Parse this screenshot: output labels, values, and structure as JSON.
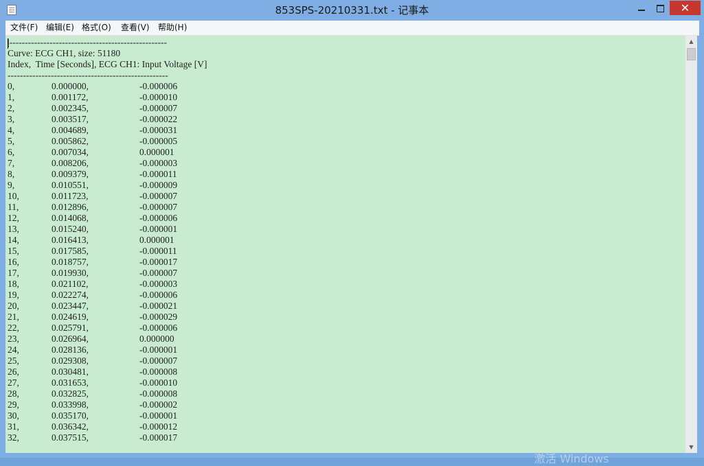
{
  "window": {
    "title": "853SPS-20210331.txt - 记事本",
    "minimize_glyph": "",
    "maximize_glyph": "",
    "close_glyph": "✕"
  },
  "menu": [
    {
      "label": "文件(F)"
    },
    {
      "label": "编辑(E)"
    },
    {
      "label": "格式(O)"
    },
    {
      "label": "查看(V)"
    },
    {
      "label": "帮助(H)"
    }
  ],
  "document": {
    "header_lines": [
      "|---------------------------------------------------",
      "Curve: ECG CH1, size: 51180",
      "Index,  Time [Seconds], ECG CH1: Input Voltage [V]",
      "----------------------------------------------------"
    ],
    "rows": [
      [
        "0,",
        "0.000000,",
        "-0.000006"
      ],
      [
        "1,",
        "0.001172,",
        "-0.000010"
      ],
      [
        "2,",
        "0.002345,",
        "-0.000007"
      ],
      [
        "3,",
        "0.003517,",
        "-0.000022"
      ],
      [
        "4,",
        "0.004689,",
        "-0.000031"
      ],
      [
        "5,",
        "0.005862,",
        "-0.000005"
      ],
      [
        "6,",
        "0.007034,",
        "0.000001"
      ],
      [
        "7,",
        "0.008206,",
        "-0.000003"
      ],
      [
        "8,",
        "0.009379,",
        "-0.000011"
      ],
      [
        "9,",
        "0.010551,",
        "-0.000009"
      ],
      [
        "10,",
        "0.011723,",
        "-0.000007"
      ],
      [
        "11,",
        "0.012896,",
        "-0.000007"
      ],
      [
        "12,",
        "0.014068,",
        "-0.000006"
      ],
      [
        "13,",
        "0.015240,",
        "-0.000001"
      ],
      [
        "14,",
        "0.016413,",
        "0.000001"
      ],
      [
        "15,",
        "0.017585,",
        "-0.000011"
      ],
      [
        "16,",
        "0.018757,",
        "-0.000017"
      ],
      [
        "17,",
        "0.019930,",
        "-0.000007"
      ],
      [
        "18,",
        "0.021102,",
        "-0.000003"
      ],
      [
        "19,",
        "0.022274,",
        "-0.000006"
      ],
      [
        "20,",
        "0.023447,",
        "-0.000021"
      ],
      [
        "21,",
        "0.024619,",
        "-0.000029"
      ],
      [
        "22,",
        "0.025791,",
        "-0.000006"
      ],
      [
        "23,",
        "0.026964,",
        "0.000000"
      ],
      [
        "24,",
        "0.028136,",
        "-0.000001"
      ],
      [
        "25,",
        "0.029308,",
        "-0.000007"
      ],
      [
        "26,",
        "0.030481,",
        "-0.000008"
      ],
      [
        "27,",
        "0.031653,",
        "-0.000010"
      ],
      [
        "28,",
        "0.032825,",
        "-0.000008"
      ],
      [
        "29,",
        "0.033998,",
        "-0.000002"
      ],
      [
        "30,",
        "0.035170,",
        "-0.000001"
      ],
      [
        "31,",
        "0.036342,",
        "-0.000012"
      ],
      [
        "32,",
        "0.037515,",
        "-0.000017"
      ]
    ]
  },
  "scrollbar": {
    "up_glyph": "▲",
    "down_glyph": "▼"
  },
  "watermark": "激活 Windows",
  "colors": {
    "editor_background": "#c9ecd0",
    "titlebar": "#7eaee3",
    "close_button": "#c7372f"
  }
}
